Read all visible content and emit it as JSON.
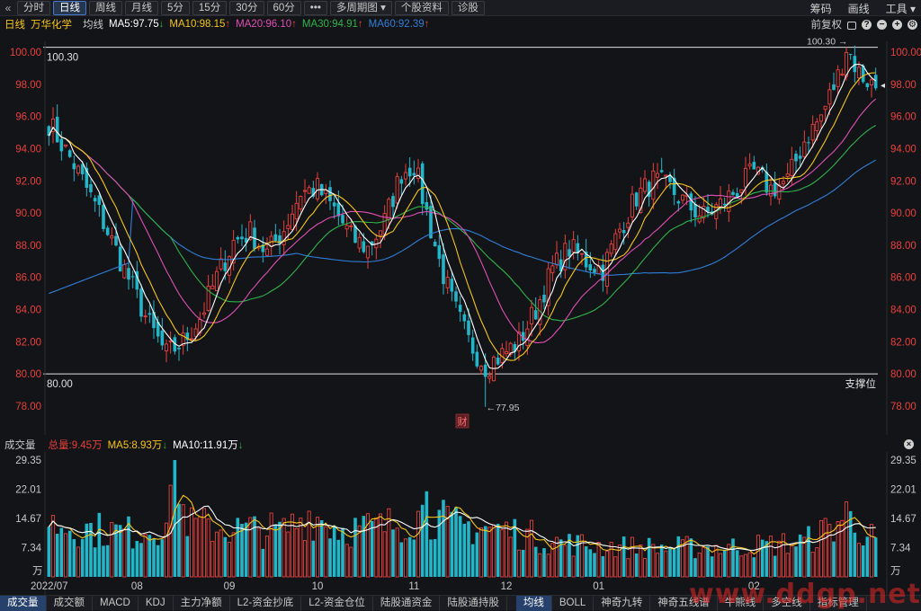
{
  "toolbar": {
    "back": "«",
    "buttons": [
      "分时",
      "日线",
      "周线",
      "月线",
      "5分",
      "15分",
      "30分",
      "60分",
      "•••",
      "多周期图 ▾",
      "个股资料",
      "诊股"
    ],
    "right": [
      "筹码",
      "画线",
      "工具 ▾"
    ]
  },
  "legend": {
    "period": "日线",
    "stock": "万华化学",
    "ma_label": "均线",
    "ma5": "MA5:97.75",
    "ma10": "MA10:98.15",
    "ma20": "MA20:96.10",
    "ma30": "MA30:94.91",
    "ma60": "MA60:92.39",
    "adjust": "前复权",
    "arrow_down": "↓",
    "arrow_up": "↑"
  },
  "colors": {
    "up": "#e8413c",
    "down": "#23b6c9",
    "ma5": "#ffffff",
    "ma10": "#f5c518",
    "ma20": "#e04fb4",
    "ma30": "#2fb34a",
    "ma60": "#2f7fd8",
    "axis_red": "#e8413c"
  },
  "main_chart": {
    "top_line_label": "100.30",
    "top_line_label_right": "100.30 →",
    "support_line_label": "80.00",
    "support_label": "支撑位",
    "low_marker": "←77.95",
    "cai_badge": "财",
    "price_marker": "◂",
    "y_ticks": [
      "100.00",
      "98.00",
      "96.00",
      "94.00",
      "92.00",
      "90.00",
      "88.00",
      "86.00",
      "84.00",
      "82.00",
      "80.00",
      "78.00"
    ]
  },
  "volume": {
    "title": "成交量",
    "total": "总量:9.45万",
    "ma5": "MA5:8.93万",
    "ma10": "MA10:11.91万",
    "y_ticks": [
      "29.35",
      "22.01",
      "14.67",
      "7.34"
    ],
    "unit": "万",
    "close_icon": "×"
  },
  "x_axis": {
    "labels": [
      "2022/07",
      "08",
      "09",
      "10",
      "11",
      "12",
      "01",
      "02"
    ]
  },
  "bottom_tabs": {
    "left": [
      "成交量",
      "成交额",
      "MACD",
      "KDJ",
      "主力净额",
      "L2-资金抄底",
      "L2-资金仓位",
      "陆股通资金",
      "陆股通持股"
    ],
    "right": [
      "均线",
      "BOLL",
      "神奇九转",
      "神奇五线谱",
      "牛熊线",
      "多空线",
      "指标管理"
    ]
  },
  "watermark": "www.ddgp.net",
  "chart_data": {
    "type": "candlestick",
    "title": "万华化学 日线",
    "ylim": [
      77.0,
      100.5
    ],
    "volume_ylim": [
      0,
      29.35
    ],
    "x_labels": [
      "2022/07",
      "08",
      "09",
      "10",
      "11",
      "12",
      "01",
      "02"
    ],
    "ma_end_values": {
      "MA5": 97.75,
      "MA10": 98.15,
      "MA20": 96.1,
      "MA30": 94.91,
      "MA60": 92.39
    },
    "high": 100.3,
    "low": 77.95,
    "support": 80.0,
    "anchors": [
      [
        0,
        95.6
      ],
      [
        6,
        93.0
      ],
      [
        12,
        90.0
      ],
      [
        18,
        86.5
      ],
      [
        24,
        83.0
      ],
      [
        28,
        81.2
      ],
      [
        32,
        82.0
      ],
      [
        36,
        83.5
      ],
      [
        40,
        86.0
      ],
      [
        44,
        88.2
      ],
      [
        48,
        88.8
      ],
      [
        52,
        87.5
      ],
      [
        56,
        89.0
      ],
      [
        60,
        91.3
      ],
      [
        64,
        91.5
      ],
      [
        68,
        90.2
      ],
      [
        72,
        88.5
      ],
      [
        76,
        87.8
      ],
      [
        80,
        89.5
      ],
      [
        84,
        92.5
      ],
      [
        87,
        93.0
      ],
      [
        90,
        90.0
      ],
      [
        93,
        87.0
      ],
      [
        96,
        84.5
      ],
      [
        100,
        82.0
      ],
      [
        104,
        80.5
      ],
      [
        108,
        81.2
      ],
      [
        112,
        82.0
      ],
      [
        116,
        84.0
      ],
      [
        120,
        86.5
      ],
      [
        124,
        87.8
      ],
      [
        128,
        87.0
      ],
      [
        132,
        86.5
      ],
      [
        136,
        89.0
      ],
      [
        140,
        91.0
      ],
      [
        144,
        92.0
      ],
      [
        148,
        91.5
      ],
      [
        152,
        90.5
      ],
      [
        156,
        89.8
      ],
      [
        160,
        90.5
      ],
      [
        164,
        91.5
      ],
      [
        168,
        92.5
      ],
      [
        172,
        91.5
      ],
      [
        176,
        92.0
      ],
      [
        180,
        94.5
      ],
      [
        184,
        96.0
      ],
      [
        188,
        98.5
      ],
      [
        190,
        100.3
      ],
      [
        193,
        98.7
      ],
      [
        197,
        97.8
      ]
    ],
    "volume_anchors": [
      [
        0,
        14.5
      ],
      [
        10,
        13.0
      ],
      [
        20,
        12.0
      ],
      [
        28,
        14.5
      ],
      [
        30,
        21.5
      ],
      [
        34,
        14.0
      ],
      [
        44,
        13.0
      ],
      [
        56,
        12.5
      ],
      [
        62,
        17.0
      ],
      [
        70,
        13.0
      ],
      [
        80,
        13.5
      ],
      [
        86,
        16.0
      ],
      [
        90,
        17.5
      ],
      [
        96,
        14.0
      ],
      [
        104,
        13.5
      ],
      [
        112,
        12.0
      ],
      [
        120,
        9.5
      ],
      [
        130,
        8.5
      ],
      [
        140,
        8.0
      ],
      [
        150,
        8.0
      ],
      [
        160,
        8.0
      ],
      [
        170,
        8.5
      ],
      [
        180,
        9.5
      ],
      [
        186,
        13.0
      ],
      [
        190,
        17.0
      ],
      [
        197,
        9.45
      ]
    ]
  }
}
